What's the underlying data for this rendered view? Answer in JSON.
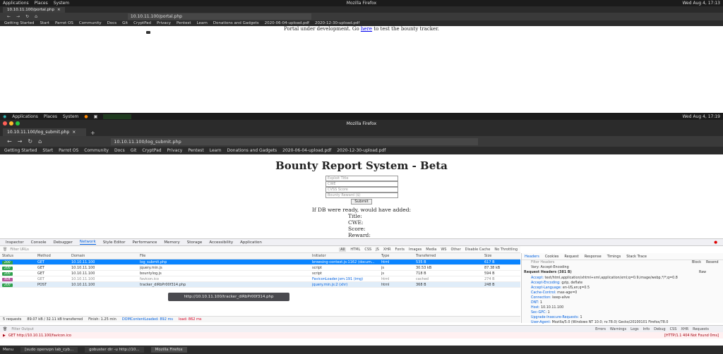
{
  "top_window": {
    "menu": [
      "Applications",
      "Places",
      "System"
    ],
    "title": "Mozilla Firefox",
    "clock": "Wed Aug 4, 17:13",
    "tab_url": "10.10.11.100/portal.php",
    "url": "10.10.11.100/portal.php",
    "bookmarks": [
      "Getting Started",
      "Start",
      "Parrot OS",
      "Community",
      "Docs",
      "Git",
      "CryptPad",
      "Privacy",
      "Pentest",
      "Learn",
      "Donations and Gadgets",
      "2020-06-04-upload.pdf",
      "2020-12-30-upload.pdf"
    ],
    "portal_text_before": "Portal under development. Go",
    "portal_link": "here",
    "portal_text_after": "to test the bounty tracker."
  },
  "bottom_window": {
    "menu": [
      "Applications",
      "Places",
      "System"
    ],
    "title": "Mozilla Firefox",
    "clock": "Wed Aug 4, 17:19",
    "tab_label": "10.10.11.100/log_submit.php",
    "url": "10.10.11.100/log_submit.php",
    "bookmarks": [
      "Getting Started",
      "Start",
      "Parrot OS",
      "Community",
      "Docs",
      "Git",
      "CryptPad",
      "Privacy",
      "Pentest",
      "Learn",
      "Donations and Gadgets",
      "2020-06-04-upload.pdf",
      "2020-12-30-upload.pdf"
    ]
  },
  "form": {
    "heading": "Bounty Report System - Beta",
    "placeholders": [
      "Exploit Title",
      "CWE",
      "CVSS Score",
      "Bounty Reward ($)"
    ],
    "submit": "Submit",
    "result_title": "If DB were ready, would have added:",
    "result_fields": [
      "Title:",
      "CWE:",
      "Score:",
      "Reward:"
    ]
  },
  "devtools": {
    "tabs": [
      "Inspector",
      "Console",
      "Debugger",
      "Network",
      "Style Editor",
      "Performance",
      "Memory",
      "Storage",
      "Accessibility",
      "Application"
    ],
    "active_tab": "Network",
    "filter_placeholder": "Filter URLs",
    "type_filters": [
      "All",
      "HTML",
      "CSS",
      "JS",
      "XHR",
      "Fonts",
      "Images",
      "Media",
      "WS",
      "Other"
    ],
    "disable_cache": "Disable Cache",
    "throttling": "No Throttling",
    "columns": [
      "Status",
      "Method",
      "Domain",
      "File",
      "Initiator",
      "Type",
      "Transferred",
      "Size"
    ],
    "rows": [
      {
        "status": "200",
        "method": "GET",
        "domain": "10.10.11.100",
        "file": "log_submit.php",
        "initiator": "browsing-context.js:1162 (docum...",
        "type": "html",
        "transferred": "535 B",
        "size": "617 B",
        "selected": true
      },
      {
        "status": "200",
        "method": "GET",
        "domain": "10.10.11.100",
        "file": "jquery.min.js",
        "initiator": "script",
        "type": "js",
        "transferred": "30.53 kB",
        "size": "87.38 kB",
        "selected": false
      },
      {
        "status": "200",
        "method": "GET",
        "domain": "10.10.11.100",
        "file": "bountylog.js",
        "initiator": "script",
        "type": "js",
        "transferred": "718 B",
        "size": "594 B",
        "selected": false
      },
      {
        "status": "404",
        "method": "GET",
        "domain": "10.10.11.100",
        "file": "favicon.ico",
        "initiator": "FaviconLoader.jsm:191 (img)",
        "type": "html",
        "transferred": "cached",
        "size": "274 B",
        "selected": false
      },
      {
        "status": "200",
        "method": "POST",
        "domain": "10.10.11.100",
        "file": "tracker_diRbPr00f314.php",
        "initiator": "jquery.min.js:2 (xhr)",
        "type": "html",
        "transferred": "368 B",
        "size": "248 B",
        "selected": false
      }
    ],
    "tooltip": "http://10.10.11.100/tracker_diRbPr00f314.php",
    "summary": {
      "requests": "5 requests",
      "transferred": "89.07 kB / 32.11 kB transferred",
      "finish": "Finish: 1.25 min",
      "dom": "DOMContentLoaded: 892 ms",
      "load": "load: 862 ms"
    },
    "side_tabs": [
      "Headers",
      "Cookies",
      "Request",
      "Response",
      "Timings",
      "Stack Trace"
    ],
    "filter_headers": "Filter Headers",
    "block": "Block",
    "resend": "Resend",
    "vary": "Vary: Accept-Encoding",
    "request_headers_title": "Request Headers (381 B)",
    "raw": "Raw",
    "request_headers": [
      {
        "k": "Accept:",
        "v": "text/html,application/xhtml+xml,application/xml;q=0.9,image/webp,*/*;q=0.8"
      },
      {
        "k": "Accept-Encoding:",
        "v": "gzip, deflate"
      },
      {
        "k": "Accept-Language:",
        "v": "en-US,en;q=0.5"
      },
      {
        "k": "Cache-Control:",
        "v": "max-age=0"
      },
      {
        "k": "Connection:",
        "v": "keep-alive"
      },
      {
        "k": "DNT:",
        "v": "1"
      },
      {
        "k": "Host:",
        "v": "10.10.11.100"
      },
      {
        "k": "Sec-GPC:",
        "v": "1"
      },
      {
        "k": "Upgrade-Insecure-Requests:",
        "v": "1"
      },
      {
        "k": "User-Agent:",
        "v": "Mozilla/5.0 (Windows NT 10.0; rv:78.0) Gecko/20100101 Firefox/78.0"
      }
    ],
    "console_filter": "Filter Output",
    "console_levels": [
      "Errors",
      "Warnings",
      "Logs",
      "Info",
      "Debug"
    ],
    "console_extra": [
      "CSS",
      "XHR",
      "Requests"
    ],
    "console_error": "GET http://10.10.11.100/favicon.ico",
    "console_error_status": "[HTTP/1.1 404 Not Found 0ms]"
  },
  "taskbar": {
    "menu": "Menu",
    "items": [
      "[sudo openvpn lab_cyb...",
      "gobuster dir -u http://10...",
      "Mozilla Firefox"
    ]
  },
  "colors": {
    "selected_row": "#0a84ff",
    "status_ok": "#30a14e",
    "status_404": "#b8569c",
    "link": "#0000ee"
  }
}
